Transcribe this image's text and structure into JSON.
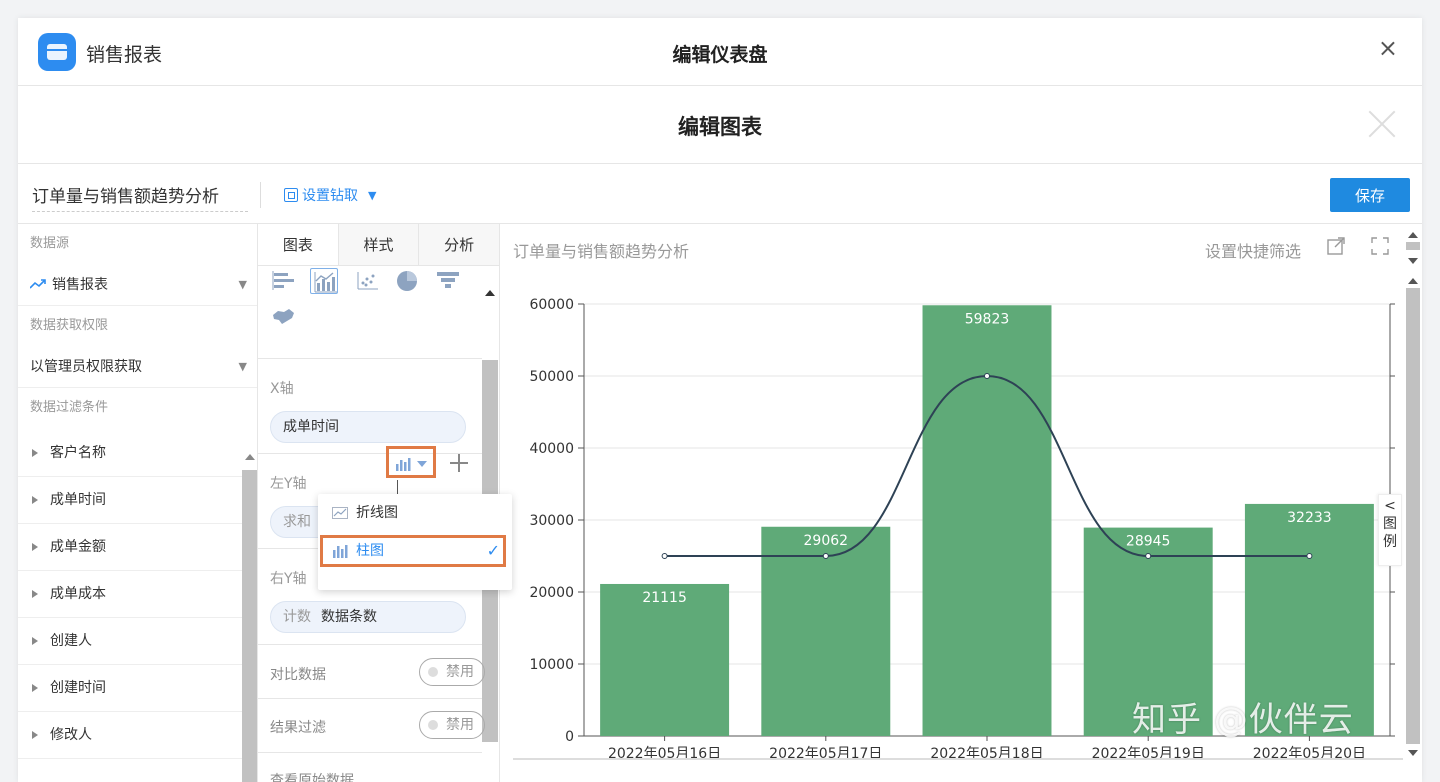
{
  "app": {
    "name": "销售报表",
    "window_title": "编辑仪表盘"
  },
  "editor": {
    "title": "编辑图表"
  },
  "toolbar": {
    "chart_name": "订单量与销售额趋势分析",
    "drill_label": "设置钻取",
    "save_label": "保存"
  },
  "left_panel": {
    "datasource_label": "数据源",
    "datasource_value": "销售报表",
    "permission_label": "数据获取权限",
    "permission_value": "以管理员权限获取",
    "filter_label": "数据过滤条件",
    "filters": [
      "客户名称",
      "成单时间",
      "成单金额",
      "成单成本",
      "创建人",
      "创建时间",
      "修改人"
    ]
  },
  "mid_panel": {
    "tabs": [
      "图表",
      "样式",
      "分析"
    ],
    "x_axis_label": "X轴",
    "x_axis_field": "成单时间",
    "left_y_label": "左Y轴",
    "left_y_agg": "求和",
    "right_y_label": "右Y轴",
    "right_y_agg": "计数",
    "right_y_field": "数据条数",
    "compare_label": "对比数据",
    "compare_toggle": "禁用",
    "result_filter_label": "结果过滤",
    "result_filter_toggle": "禁用",
    "raw_data_label": "查看原始数据"
  },
  "popup": {
    "option_line": "折线图",
    "option_bar": "柱图",
    "check": "✓"
  },
  "chart_header": {
    "title": "订单量与销售额趋势分析",
    "quick_filter": "设置快捷筛选",
    "legend_tab": "图例"
  },
  "colors": {
    "bar": "#5faa78",
    "line": "#2e4255",
    "accent": "#1f8ae0",
    "highlight": "#e07a45"
  },
  "chart_data": {
    "type": "bar",
    "categories": [
      "2022年05月16日",
      "2022年05月17日",
      "2022年05月18日",
      "2022年05月19日",
      "2022年05月20日"
    ],
    "series": [
      {
        "type": "bar",
        "values": [
          21115,
          29062,
          59823,
          28945,
          32233
        ]
      },
      {
        "type": "line",
        "values": [
          null,
          1,
          2,
          1,
          1
        ]
      }
    ],
    "ylim": [
      0,
      60000
    ],
    "yticks": [
      0,
      10000,
      20000,
      30000,
      40000,
      50000,
      60000
    ],
    "y2lim": [
      0,
      2.4
    ],
    "grid": true
  },
  "watermark": "知乎 @伙伴云"
}
